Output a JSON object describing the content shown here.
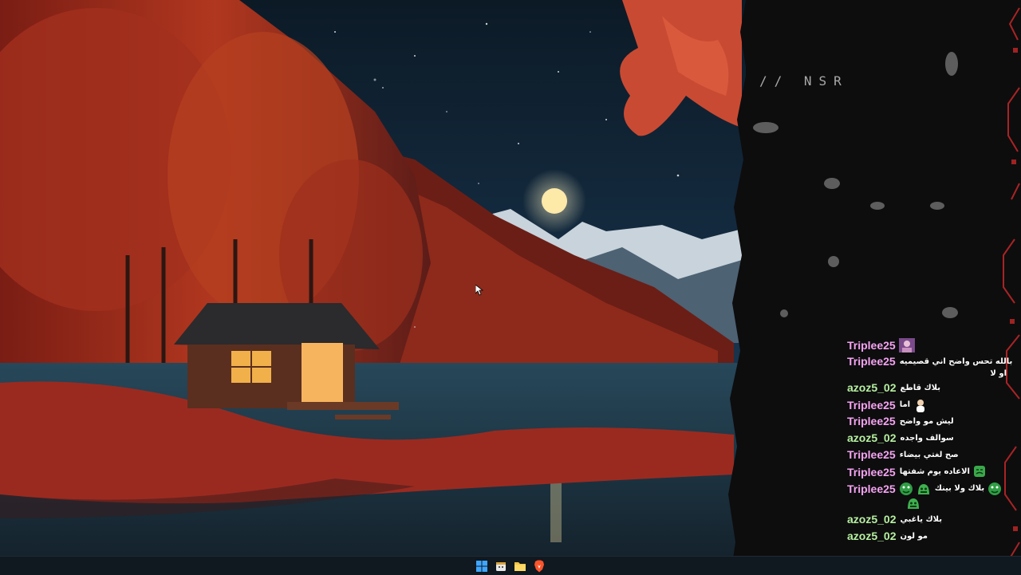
{
  "desktop": {
    "wallpaper_icon": "night-lake-cabin-wallpaper"
  },
  "overlay": {
    "brand_tag": "// NSR"
  },
  "chat": {
    "messages": [
      {
        "user": "Triplee25",
        "user_color": "#f5a3f1",
        "text": "",
        "cont": "",
        "emotes": [
          "avatar-emote"
        ]
      },
      {
        "user": "Triplee25",
        "user_color": "#f5a3f1",
        "text": "بالله تحس واضح اني قصيميه",
        "cont": "او لا",
        "emotes": []
      },
      {
        "user": "azoz5_02",
        "user_color": "#b7f0a0",
        "text": "بلاك قاطع",
        "cont": "",
        "emotes": []
      },
      {
        "user": "Triplee25",
        "user_color": "#f5a3f1",
        "text": "اما",
        "cont": "",
        "emotes": [
          "person-emote"
        ]
      },
      {
        "user": "Triplee25",
        "user_color": "#f5a3f1",
        "text": "ليش مو واضح",
        "cont": "",
        "emotes": []
      },
      {
        "user": "azoz5_02",
        "user_color": "#b7f0a0",
        "text": "سوالف واجده",
        "cont": "",
        "emotes": []
      },
      {
        "user": "Triplee25",
        "user_color": "#f5a3f1",
        "text": "صح لغتي بيضاء",
        "cont": "",
        "emotes": []
      },
      {
        "user": "Triplee25",
        "user_color": "#f5a3f1",
        "text": "الاعاده يوم شفتها",
        "cont": "",
        "emotes": [
          "green-face-emote"
        ]
      },
      {
        "user": "Triplee25",
        "user_color": "#f5a3f1",
        "text": "بلاك ولا بينك",
        "cont": "",
        "emotes": [
          "green-face-emote",
          "green-face-emote",
          "green-face-emote",
          "green-face-emote"
        ]
      },
      {
        "user": "azoz5_02",
        "user_color": "#b7f0a0",
        "text": "بلاك ياغبي",
        "cont": "",
        "emotes": []
      },
      {
        "user": "azoz5_02",
        "user_color": "#b7f0a0",
        "text": "مو لون",
        "cont": "",
        "emotes": []
      }
    ]
  },
  "taskbar": {
    "items": [
      {
        "name": "start-button",
        "icon": "windows-logo-icon"
      },
      {
        "name": "taskbar-calendar",
        "icon": "calendar-icon"
      },
      {
        "name": "taskbar-file-explorer",
        "icon": "folder-icon"
      },
      {
        "name": "taskbar-brave",
        "icon": "brave-lion-icon"
      }
    ]
  },
  "colors": {
    "accent_red": "#c62828",
    "panel": "#0d0d0e",
    "pink_user": "#f5a3f1",
    "green_user": "#b7f0a0"
  }
}
